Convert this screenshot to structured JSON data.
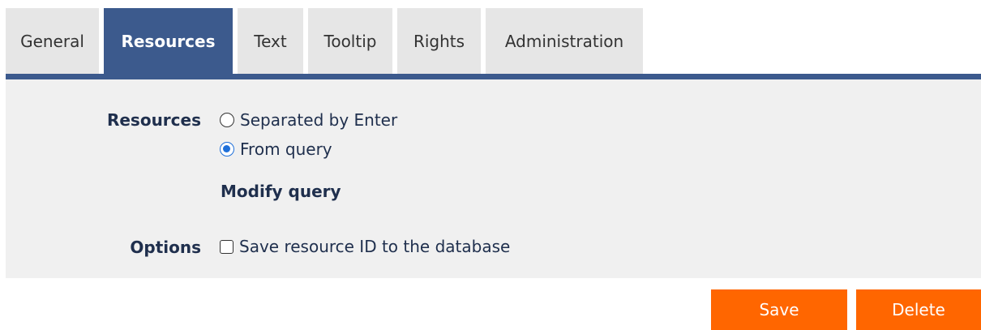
{
  "tabs": [
    {
      "label": "General",
      "active": false
    },
    {
      "label": "Resources",
      "active": true
    },
    {
      "label": "Text",
      "active": false
    },
    {
      "label": "Tooltip",
      "active": false
    },
    {
      "label": "Rights",
      "active": false
    },
    {
      "label": "Administration",
      "active": false
    }
  ],
  "form": {
    "resources_label": "Resources",
    "option_separated": "Separated by Enter",
    "option_from_query": "From query",
    "selected_option": "From query",
    "modify_query_link": "Modify query",
    "options_label": "Options",
    "save_resource_id_label": "Save resource ID to the database",
    "save_resource_id_checked": false
  },
  "buttons": {
    "save_label": "Save",
    "delete_label": "Delete"
  },
  "colors": {
    "accent": "#3c5a8d",
    "action": "#ff6600",
    "radio_selected": "#1e6fd9"
  }
}
